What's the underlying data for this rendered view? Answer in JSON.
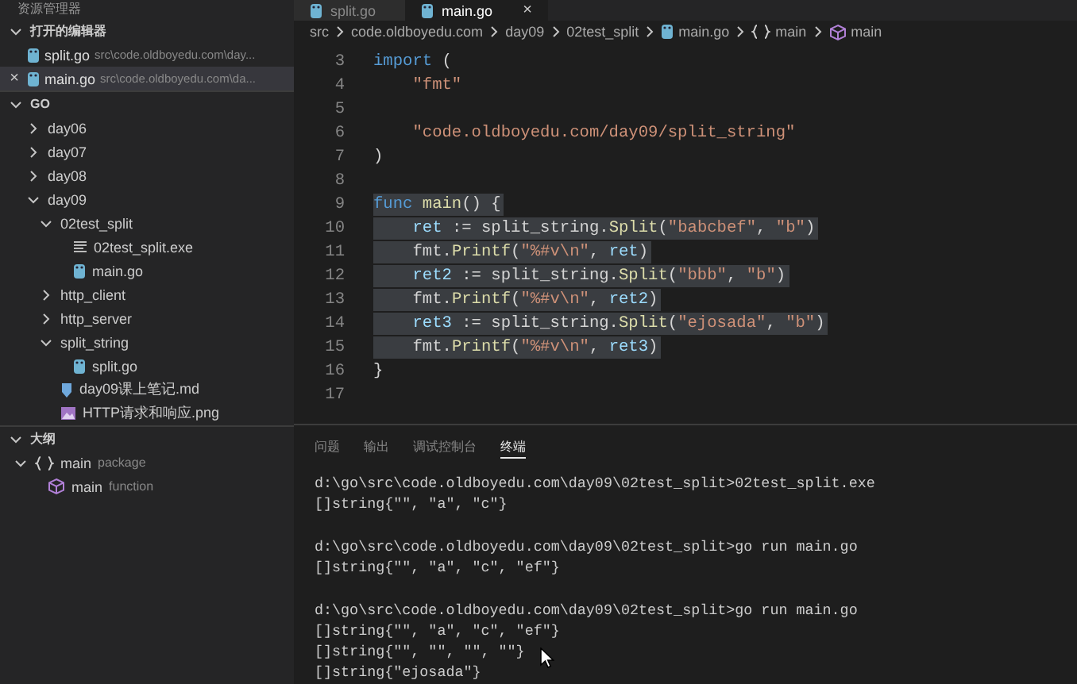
{
  "sidebar": {
    "title": "资源管理器",
    "open_editors": {
      "title": "打开的编辑器",
      "expanded": true,
      "items": [
        {
          "name": "split.go",
          "path": "src\\code.oldboyedu.com\\day...",
          "selected": false
        },
        {
          "name": "main.go",
          "path": "src\\code.oldboyedu.com\\da...",
          "selected": true,
          "close": "×"
        }
      ]
    },
    "folder": {
      "title": "GO",
      "expanded": true,
      "items": [
        {
          "label": "day06",
          "expanded": false
        },
        {
          "label": "day07",
          "expanded": false
        },
        {
          "label": "day08",
          "expanded": false
        },
        {
          "label": "day09",
          "expanded": true,
          "children": [
            {
              "label": "02test_split",
              "expanded": true,
              "children": [
                {
                  "label": "02test_split.exe",
                  "kind": "exe"
                },
                {
                  "label": "main.go",
                  "kind": "go"
                }
              ]
            },
            {
              "label": "http_client",
              "expanded": false
            },
            {
              "label": "http_server",
              "expanded": false
            },
            {
              "label": "split_string",
              "expanded": true,
              "children": [
                {
                  "label": "split.go",
                  "kind": "go"
                }
              ]
            },
            {
              "label": "day09课上笔记.md",
              "kind": "md"
            },
            {
              "label": "HTTP请求和响应.png",
              "kind": "png"
            }
          ]
        }
      ]
    },
    "outline": {
      "title": "大纲",
      "expanded": true,
      "items": [
        {
          "label": "main",
          "detail": "package",
          "kind": "package",
          "expanded": true,
          "children": [
            {
              "label": "main",
              "detail": "function",
              "kind": "function"
            }
          ]
        }
      ]
    }
  },
  "tabs": [
    {
      "label": "split.go",
      "selected": false
    },
    {
      "label": "main.go",
      "selected": true,
      "close": "×"
    }
  ],
  "breadcrumb": [
    {
      "label": "src",
      "kind": "text"
    },
    {
      "label": "code.oldboyedu.com",
      "kind": "text"
    },
    {
      "label": "day09",
      "kind": "text"
    },
    {
      "label": "02test_split",
      "kind": "text"
    },
    {
      "label": "main.go",
      "kind": "file"
    },
    {
      "label": "main",
      "kind": "package"
    },
    {
      "label": "main",
      "kind": "function"
    }
  ],
  "code": [
    {
      "num": "3",
      "selected": false,
      "tokens": [
        {
          "kind": "keyword",
          "text": "import"
        },
        {
          "kind": "plain",
          "text": " ("
        }
      ]
    },
    {
      "num": "4",
      "selected": false,
      "tokens": [
        {
          "kind": "string",
          "text": "    \"fmt\""
        }
      ]
    },
    {
      "num": "5",
      "selected": false
    },
    {
      "num": "6",
      "selected": false,
      "tokens": [
        {
          "kind": "string",
          "text": "    \"code.oldboyedu.com/day09/split_string\""
        }
      ]
    },
    {
      "num": "7",
      "selected": false,
      "tokens": [
        {
          "kind": "plain",
          "text": ")"
        }
      ]
    },
    {
      "num": "8",
      "selected": false
    },
    {
      "num": "9",
      "selected": true,
      "tokens": [
        {
          "kind": "keyword",
          "text": "func"
        },
        {
          "kind": "function",
          "text": " main"
        },
        {
          "kind": "plain",
          "text": "() {"
        }
      ]
    },
    {
      "num": "10",
      "selected": true,
      "tokens": [
        {
          "kind": "variable",
          "text": "    ret"
        },
        {
          "kind": "plain",
          "text": " := split_string."
        },
        {
          "kind": "function",
          "text": "Split"
        },
        {
          "kind": "plain",
          "text": "("
        },
        {
          "kind": "string",
          "text": "\"babcbef\""
        },
        {
          "kind": "plain",
          "text": ", "
        },
        {
          "kind": "string",
          "text": "\"b\""
        },
        {
          "kind": "plain",
          "text": ")"
        }
      ]
    },
    {
      "num": "11",
      "selected": true,
      "tokens": [
        {
          "kind": "plain",
          "text": "    fmt."
        },
        {
          "kind": "function",
          "text": "Printf"
        },
        {
          "kind": "plain",
          "text": "("
        },
        {
          "kind": "string",
          "text": "\"%#v\\n\""
        },
        {
          "kind": "plain",
          "text": ", "
        },
        {
          "kind": "variable",
          "text": "ret"
        },
        {
          "kind": "plain",
          "text": ")"
        }
      ]
    },
    {
      "num": "12",
      "selected": true,
      "tokens": [
        {
          "kind": "variable",
          "text": "    ret2"
        },
        {
          "kind": "plain",
          "text": " := split_string."
        },
        {
          "kind": "function",
          "text": "Split"
        },
        {
          "kind": "plain",
          "text": "("
        },
        {
          "kind": "string",
          "text": "\"bbb\""
        },
        {
          "kind": "plain",
          "text": ", "
        },
        {
          "kind": "string",
          "text": "\"b\""
        },
        {
          "kind": "plain",
          "text": ")"
        }
      ]
    },
    {
      "num": "13",
      "selected": true,
      "tokens": [
        {
          "kind": "plain",
          "text": "    fmt."
        },
        {
          "kind": "function",
          "text": "Printf"
        },
        {
          "kind": "plain",
          "text": "("
        },
        {
          "kind": "string",
          "text": "\"%#v\\n\""
        },
        {
          "kind": "plain",
          "text": ", "
        },
        {
          "kind": "variable",
          "text": "ret2"
        },
        {
          "kind": "plain",
          "text": ")"
        }
      ]
    },
    {
      "num": "14",
      "selected": true,
      "tokens": [
        {
          "kind": "variable",
          "text": "    ret3"
        },
        {
          "kind": "plain",
          "text": " := split_string."
        },
        {
          "kind": "function",
          "text": "Split"
        },
        {
          "kind": "plain",
          "text": "("
        },
        {
          "kind": "string",
          "text": "\"ejosada\""
        },
        {
          "kind": "plain",
          "text": ", "
        },
        {
          "kind": "string",
          "text": "\"b\""
        },
        {
          "kind": "plain",
          "text": ")"
        }
      ]
    },
    {
      "num": "15",
      "selected": true,
      "tokens": [
        {
          "kind": "plain",
          "text": "    fmt."
        },
        {
          "kind": "function",
          "text": "Printf"
        },
        {
          "kind": "plain",
          "text": "("
        },
        {
          "kind": "string",
          "text": "\"%#v\\n\""
        },
        {
          "kind": "plain",
          "text": ", "
        },
        {
          "kind": "variable",
          "text": "ret3"
        },
        {
          "kind": "plain",
          "text": ")"
        }
      ]
    },
    {
      "num": "16",
      "selected": false,
      "tokens": [
        {
          "kind": "plain",
          "text": "}"
        }
      ]
    },
    {
      "num": "17",
      "selected": false
    }
  ],
  "panel_tabs": [
    {
      "label": "问题",
      "selected": false
    },
    {
      "label": "输出",
      "selected": false
    },
    {
      "label": "调试控制台",
      "selected": false
    },
    {
      "label": "终端",
      "selected": true
    }
  ],
  "terminal": [
    [
      "d:\\go\\src\\code.oldboyedu.com\\day09\\02test_split>02test_split.exe",
      "[]string{\"\", \"a\", \"c\"}"
    ],
    [
      "d:\\go\\src\\code.oldboyedu.com\\day09\\02test_split>go run main.go",
      "[]string{\"\", \"a\", \"c\", \"ef\"}"
    ],
    [
      "d:\\go\\src\\code.oldboyedu.com\\day09\\02test_split>go run main.go",
      "[]string{\"\", \"a\", \"c\", \"ef\"}",
      "[]string{\"\", \"\", \"\", \"\"}",
      "[]string{\"ejosada\"}"
    ]
  ]
}
